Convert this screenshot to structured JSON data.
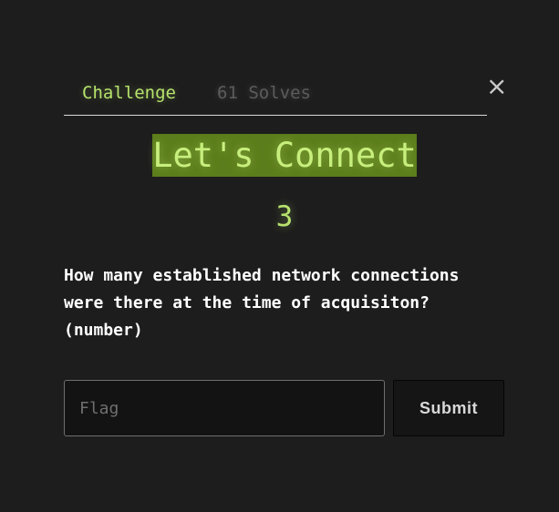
{
  "tabs": {
    "challenge_label": "Challenge",
    "solves_label": "61 Solves"
  },
  "close": {
    "symbol": "×",
    "icon": "close-icon"
  },
  "challenge": {
    "title": "Let's Connect",
    "points": "3",
    "description": "How many established network connections\nwere there at the time of acquisiton?\n(number)"
  },
  "form": {
    "flag_placeholder": "Flag",
    "flag_value": "",
    "submit_label": "Submit"
  },
  "colors": {
    "background": "#1d1d1d",
    "accent_green": "#b6e36c",
    "title_highlight": "#5c7d1b",
    "muted_text": "#5c5c5c"
  }
}
